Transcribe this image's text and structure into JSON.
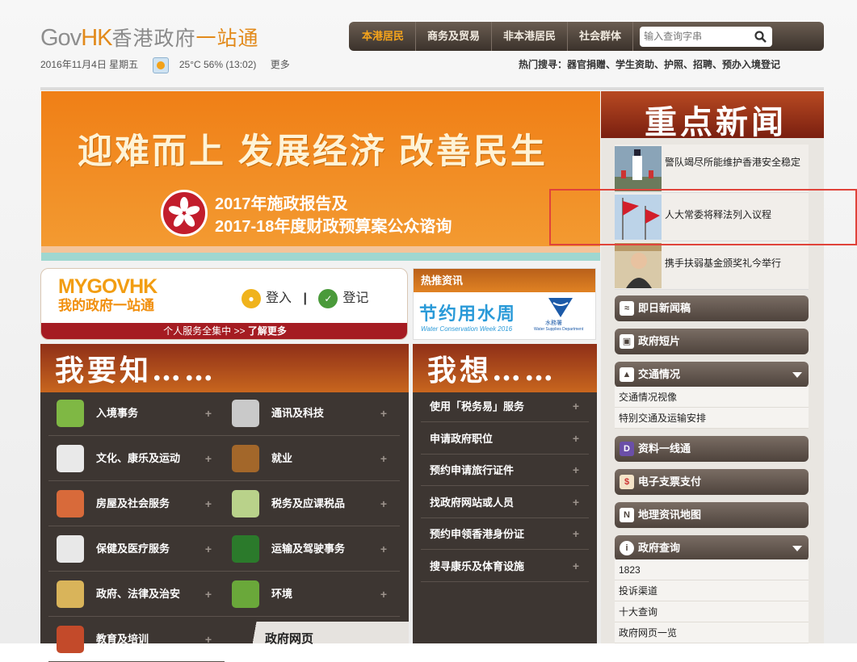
{
  "header": {
    "logo_gov": "Gov",
    "logo_hk": "HK",
    "logo_cn": "香港政府",
    "logo_one": "一",
    "logo_tail": "站通",
    "date": "2016年11月4日 星期五",
    "weather": "25°C 56% (13:02)",
    "more": "更多",
    "nav_tabs": [
      "本港居民",
      "商务及贸易",
      "非本港居民",
      "社会群体"
    ],
    "search_placeholder": "输入查询字串",
    "hot_search_label": "热门搜寻：",
    "hot_search_items": "器官捐赠、学生资助、护照、招聘、预办入境登记"
  },
  "banner": {
    "title": "迎难而上  发展经济  改善民生",
    "line1": "2017年施政报告及",
    "line2": "2017-18年度财政预算案公众谘询"
  },
  "mygovhk": {
    "logo": "MYGOVHK",
    "logo_cn": "我的政府一站通",
    "login": "登入",
    "separator": "|",
    "register": "登记",
    "bar_text": "个人服务全集中 >> ",
    "bar_link": "了解更多"
  },
  "hot_news": {
    "title": "热推资讯",
    "water_cn": "节约用水周",
    "water_en": "Water Conservation Week 2016",
    "water_dept_cn": "水務署",
    "water_dept_en": "Water Supplies Department"
  },
  "know": {
    "title": "我要知……",
    "items": [
      "入境事务",
      "通讯及科技",
      "文化、康乐及运动",
      "就业",
      "房屋及社会服务",
      "税务及应课税品",
      "保健及医疗服务",
      "运输及驾驶事务",
      "政府、法律及治安",
      "环境",
      "教育及培训"
    ],
    "gov_web": "政府网页"
  },
  "want": {
    "title": "我想……",
    "items": [
      "使用「税务易」服务",
      "申请政府职位",
      "预约申请旅行证件",
      "找政府网站或人员",
      "预约申领香港身份证",
      "搜寻康乐及体育设施"
    ]
  },
  "news": {
    "title": "重点新闻",
    "items": [
      "警队竭尽所能维护香港安全稳定",
      "人大常委将释法列入议程",
      "携手扶弱基金颁奖礼今举行"
    ],
    "buttons": {
      "instant": "即日新闻稿",
      "video": "政府短片",
      "traffic": "交通情况",
      "traffic_links": [
        "交通情况视像",
        "特别交通及运输安排"
      ],
      "data": "资料一线通",
      "epay": "电子支票支付",
      "geo": "地理资讯地图",
      "enquiry": "政府查询",
      "enquiry_links": [
        "1823",
        "投诉渠道",
        "十大查询",
        "政府网页一览"
      ]
    }
  },
  "colors": {
    "accent_orange": "#f07f16",
    "nav_active": "#f7a51b",
    "brand_red": "#a51c22"
  }
}
